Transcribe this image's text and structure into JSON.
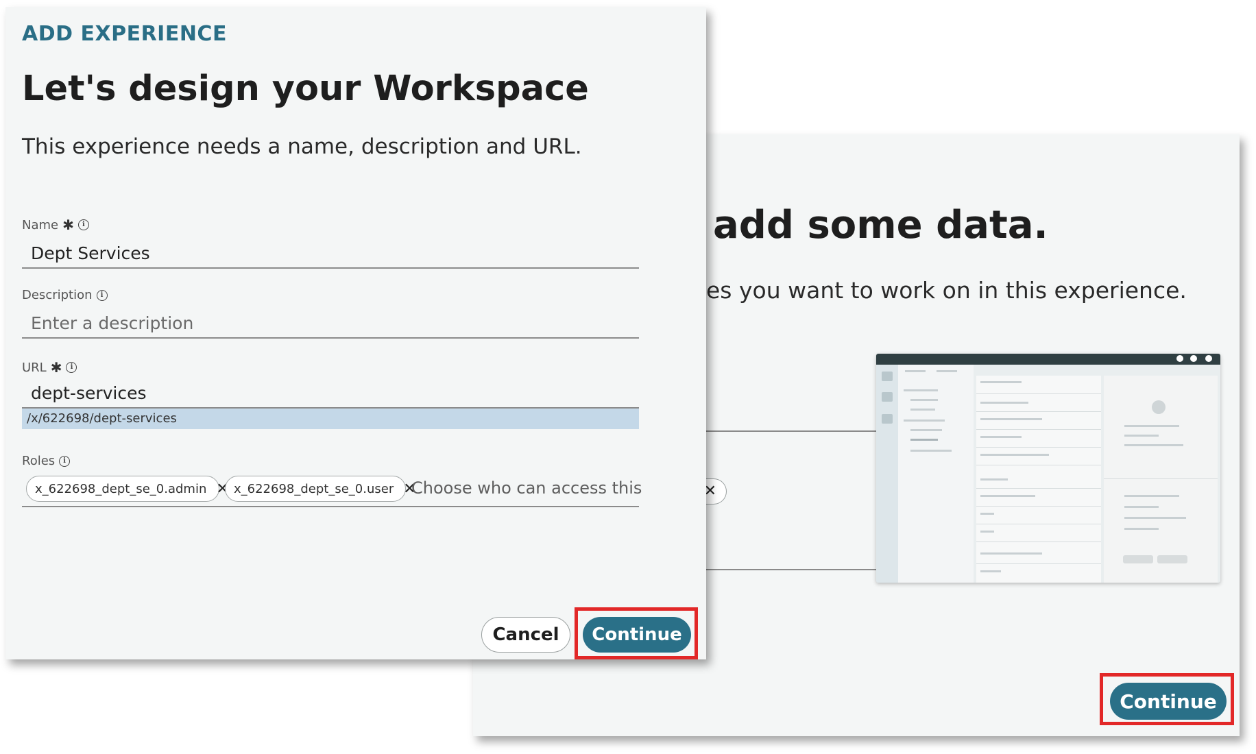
{
  "back_panel": {
    "title": "add some data.",
    "subtitle": "es you want to work on in this experience.",
    "chip_close": "✕",
    "continue_label": "Continue"
  },
  "dialog": {
    "eyebrow": "ADD EXPERIENCE",
    "title": "Let's design your Workspace",
    "subtitle": "This experience needs a name, description and URL.",
    "required_mark": "✱",
    "info_glyph": "i",
    "name": {
      "label": "Name",
      "value": "Dept Services"
    },
    "description": {
      "label": "Description",
      "placeholder": "Enter a description"
    },
    "url": {
      "label": "URL",
      "value": "dept-services",
      "hint": "/x/622698/dept-services"
    },
    "roles": {
      "label": "Roles",
      "chips": [
        {
          "text": "x_622698_dept_se_0.admin",
          "remove": "✕"
        },
        {
          "text": "x_622698_dept_se_0.user",
          "remove": "✕"
        }
      ],
      "placeholder": "Choose who can access this"
    },
    "cancel_label": "Cancel",
    "continue_label": "Continue"
  },
  "colors": {
    "accent": "#2a7088",
    "eyebrow": "#2a6e86",
    "highlight_border": "#e22828",
    "url_hint_bg": "#c4d8e8",
    "panel_bg": "#f4f6f6"
  },
  "icons": [
    "info-icon",
    "required-asterisk-icon",
    "close-icon",
    "workspace-preview-illustration"
  ]
}
